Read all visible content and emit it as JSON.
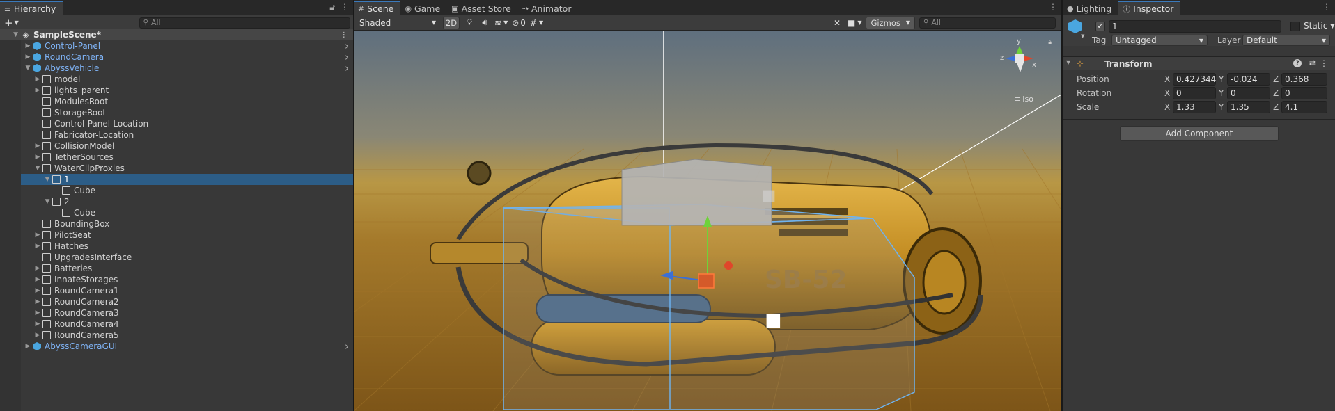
{
  "hierarchy": {
    "tab_label": "Hierarchy",
    "search_placeholder": "All",
    "scene_name": "SampleScene*",
    "items": [
      {
        "label": "Control-Panel",
        "depth": 1,
        "arrow": "closed",
        "prefab": true,
        "chevron": true
      },
      {
        "label": "RoundCamera",
        "depth": 1,
        "arrow": "closed",
        "prefab": true,
        "chevron": true
      },
      {
        "label": "AbyssVehicle",
        "depth": 1,
        "arrow": "open",
        "prefab": true,
        "chevron": true
      },
      {
        "label": "model",
        "depth": 2,
        "arrow": "closed",
        "prefab": false
      },
      {
        "label": "lights_parent",
        "depth": 2,
        "arrow": "closed",
        "prefab": false
      },
      {
        "label": "ModulesRoot",
        "depth": 2,
        "arrow": "none",
        "prefab": false
      },
      {
        "label": "StorageRoot",
        "depth": 2,
        "arrow": "none",
        "prefab": false
      },
      {
        "label": "Control-Panel-Location",
        "depth": 2,
        "arrow": "none",
        "prefab": false
      },
      {
        "label": "Fabricator-Location",
        "depth": 2,
        "arrow": "none",
        "prefab": false
      },
      {
        "label": "CollisionModel",
        "depth": 2,
        "arrow": "closed",
        "prefab": false
      },
      {
        "label": "TetherSources",
        "depth": 2,
        "arrow": "closed",
        "prefab": false
      },
      {
        "label": "WaterClipProxies",
        "depth": 2,
        "arrow": "open",
        "prefab": false
      },
      {
        "label": "1",
        "depth": 3,
        "arrow": "open",
        "prefab": false,
        "selected": true
      },
      {
        "label": "Cube",
        "depth": 4,
        "arrow": "none",
        "prefab": false
      },
      {
        "label": "2",
        "depth": 3,
        "arrow": "open",
        "prefab": false
      },
      {
        "label": "Cube",
        "depth": 4,
        "arrow": "none",
        "prefab": false
      },
      {
        "label": "BoundingBox",
        "depth": 2,
        "arrow": "none",
        "prefab": false
      },
      {
        "label": "PilotSeat",
        "depth": 2,
        "arrow": "closed",
        "prefab": false
      },
      {
        "label": "Hatches",
        "depth": 2,
        "arrow": "closed",
        "prefab": false
      },
      {
        "label": "UpgradesInterface",
        "depth": 2,
        "arrow": "none",
        "prefab": false
      },
      {
        "label": "Batteries",
        "depth": 2,
        "arrow": "closed",
        "prefab": false
      },
      {
        "label": "InnateStorages",
        "depth": 2,
        "arrow": "closed",
        "prefab": false
      },
      {
        "label": "RoundCamera1",
        "depth": 2,
        "arrow": "closed",
        "prefab": false
      },
      {
        "label": "RoundCamera2",
        "depth": 2,
        "arrow": "closed",
        "prefab": false
      },
      {
        "label": "RoundCamera3",
        "depth": 2,
        "arrow": "closed",
        "prefab": false
      },
      {
        "label": "RoundCamera4",
        "depth": 2,
        "arrow": "closed",
        "prefab": false
      },
      {
        "label": "RoundCamera5",
        "depth": 2,
        "arrow": "closed",
        "prefab": false
      },
      {
        "label": "AbyssCameraGUI",
        "depth": 1,
        "arrow": "closed",
        "prefab": true,
        "chevron": true
      }
    ]
  },
  "scene": {
    "tabs": [
      {
        "label": "Scene",
        "icon": "grid-icon",
        "active": true
      },
      {
        "label": "Game",
        "icon": "gamepad-icon",
        "active": false
      },
      {
        "label": "Asset Store",
        "icon": "bag-icon",
        "active": false
      },
      {
        "label": "Animator",
        "icon": "animator-icon",
        "active": false
      }
    ],
    "shading_mode": "Shaded",
    "mode_2d": "2D",
    "hidden_count": "0",
    "gizmos_label": "Gizmos",
    "search_placeholder": "All",
    "view_label": "Iso",
    "gizmo_axes": {
      "y": "y",
      "z": "z",
      "x": "x"
    },
    "vehicle_decal": "SB-52"
  },
  "inspector": {
    "tabs": [
      {
        "label": "Lighting",
        "icon": "bulb-icon",
        "active": false
      },
      {
        "label": "Inspector",
        "icon": "info-icon",
        "active": true
      }
    ],
    "object_name": "1",
    "static_label": "Static",
    "tag_label": "Tag",
    "tag_value": "Untagged",
    "layer_label": "Layer",
    "layer_value": "Default",
    "component_title": "Transform",
    "rows": [
      {
        "label": "Position",
        "x": "0.427344",
        "y": "-0.024",
        "z": "0.368"
      },
      {
        "label": "Rotation",
        "x": "0",
        "y": "0",
        "z": "0"
      },
      {
        "label": "Scale",
        "x": "1.33",
        "y": "1.35",
        "z": "4.1"
      }
    ],
    "axis_labels": {
      "x": "X",
      "y": "Y",
      "z": "Z"
    },
    "add_component_label": "Add Component"
  },
  "colors": {
    "selection": "#2c5d87",
    "prefab_text": "#7fb3f5",
    "tab_accent": "#3a79bb"
  }
}
